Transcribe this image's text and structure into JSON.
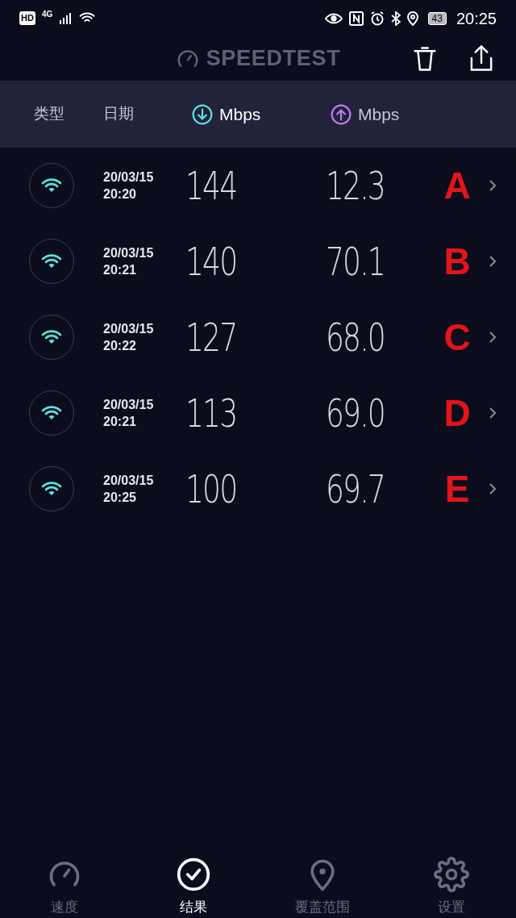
{
  "status_bar": {
    "badges": [
      "HD",
      "4G"
    ],
    "battery": "43",
    "time": "20:25"
  },
  "header": {
    "title": "SPEEDTEST"
  },
  "columns": [
    {
      "kind": "text",
      "label": "类型"
    },
    {
      "kind": "text",
      "label": "日期"
    },
    {
      "kind": "download",
      "label": "Mbps"
    },
    {
      "kind": "upload",
      "label": "Mbps"
    }
  ],
  "results": [
    {
      "date": "20/03/15",
      "time": "20:20",
      "download": "144",
      "upload": "12.3",
      "note": "A"
    },
    {
      "date": "20/03/15",
      "time": "20:21",
      "download": "140",
      "upload": "70.1",
      "note": "B"
    },
    {
      "date": "20/03/15",
      "time": "20:22",
      "download": "127",
      "upload": "68.0",
      "note": "C"
    },
    {
      "date": "20/03/15",
      "time": "20:21",
      "download": "113",
      "upload": "69.0",
      "note": "D"
    },
    {
      "date": "20/03/15",
      "time": "20:25",
      "download": "100",
      "upload": "69.7",
      "note": "E"
    }
  ],
  "nav": [
    {
      "kind": "speed",
      "label": "速度",
      "selected": false
    },
    {
      "kind": "results",
      "label": "结果",
      "selected": true
    },
    {
      "kind": "coverage",
      "label": "覆盖范围",
      "selected": false
    },
    {
      "kind": "settings",
      "label": "设置",
      "selected": false
    }
  ]
}
